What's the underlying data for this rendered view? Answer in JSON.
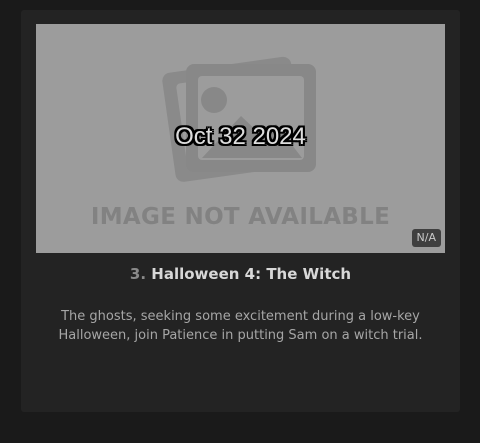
{
  "episode": {
    "air_date": "Oct 32 2024",
    "placeholder_text": "IMAGE NOT AVAILABLE",
    "rating": "N/A",
    "number": "3.",
    "title": "Halloween 4: The Witch",
    "description": "The ghosts, seeking some excitement during a low-key Halloween, join Patience in putting Sam on a witch trial."
  },
  "icons": {
    "placeholder": "image-placeholder-icon"
  }
}
